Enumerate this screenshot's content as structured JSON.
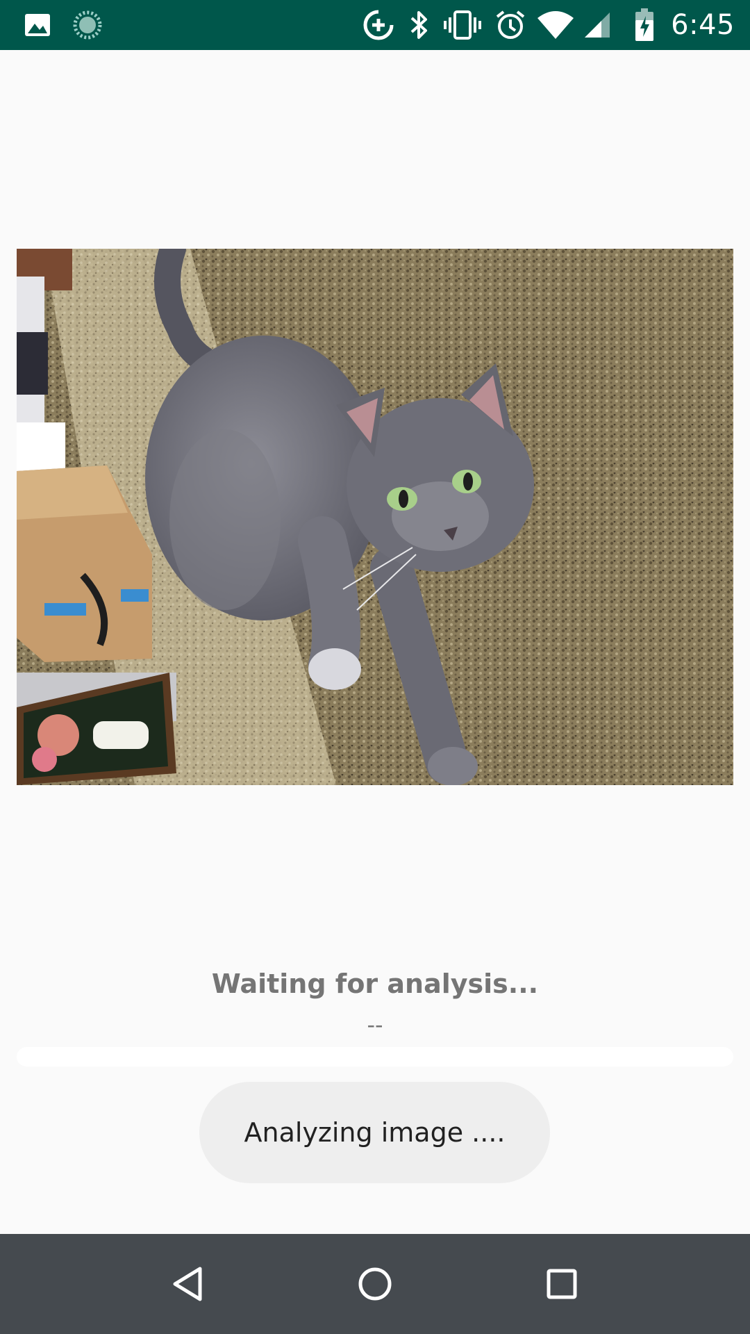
{
  "status_bar": {
    "time": "6:45",
    "icons": [
      "image-icon",
      "sync-icon",
      "data-saver-icon",
      "bluetooth-icon",
      "vibrate-icon",
      "alarm-icon",
      "wifi-icon",
      "signal-icon",
      "battery-charging-icon"
    ]
  },
  "photo": {
    "subject": "cat-photo"
  },
  "analysis": {
    "title": "Waiting for analysis...",
    "subtitle": "--",
    "progress": 0
  },
  "toast": {
    "message": "Analyzing image ...."
  },
  "nav_bar": {
    "buttons": [
      "back-icon",
      "home-icon",
      "recents-icon"
    ]
  },
  "colors": {
    "status_bar": "#00574b",
    "background": "#fafafa",
    "nav_bar": "#454a4f",
    "text_gray": "#757575",
    "toast_bg": "#eeeeee"
  }
}
